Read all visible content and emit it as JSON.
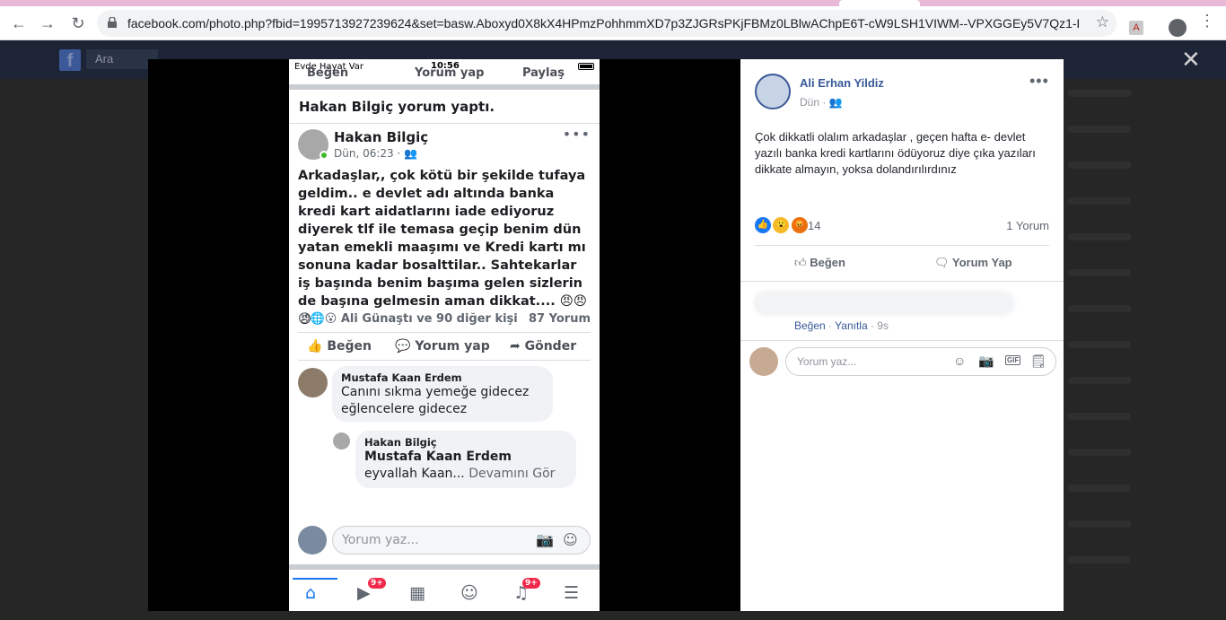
{
  "browser": {
    "url": "facebook.com/photo.php?fbid=1995713927239624&set=basw.Aboxyd0X8kX4HPmzPohhmmXD7p3ZJGRsPKjFBMz0LBlwAChpE6T-cW9LSH1VIWM--VPXGGEy5V7Qz1-Lc6s...",
    "back": "←",
    "forward": "→",
    "reload": "↻",
    "star": "☆",
    "pdf": "A",
    "menu": "⋮"
  },
  "facebook": {
    "logo": "f",
    "search_placeholder": "Ara",
    "close": "✕"
  },
  "phone": {
    "status": {
      "carrier": "Evde Hayat Var",
      "time": "10:56"
    },
    "cut_actions": {
      "like": "Beğen",
      "comment": "Yorum yap",
      "share": "Paylaş"
    },
    "notification": "Hakan Bilgiç yorum yaptı.",
    "post": {
      "author": "Hakan Bilgiç",
      "meta": "Dün, 06:23 · 👥",
      "more": "•••",
      "body": "Arkadaşlar,, çok kötü bir şekilde tufaya geldim.. e devlet adı altında banka kredi kart aidatlarını iade ediyoruz diyerek tlf ile temasa geçip benim dün yatan emekli maaşımı ve Kredi kartı mı sonuna  kadar bosalttilar.. Sahtekarlar iş başında benim başıma gelen sizlerin de başına gelmesin aman dikkat.... 😠😠😠",
      "reactions": "😠🌐😮 Ali Günaştı ve 90 diğer kişi",
      "comments_count": "87 Yorum"
    },
    "actions": {
      "like": "Beğen",
      "comment": "Yorum yap",
      "send": "Gönder"
    },
    "comments": [
      {
        "name": "Mustafa Kaan Erdem",
        "text1": "Canını sıkma yemeğe gidecez",
        "text2": "eğlencelere gidecez"
      },
      {
        "name": "Hakan Bilgiç",
        "text1": "Mustafa Kaan Erdem",
        "text2": "eyvallah Kaan...",
        "more": "Devamını Gör"
      }
    ],
    "composer_placeholder": "Yorum yaz...",
    "tabs": {
      "video_badge": "9+",
      "notif_badge": "9+"
    }
  },
  "panel": {
    "author": "Ali Erhan Yildiz",
    "meta": "Dün · 👥",
    "more": "•••",
    "text": "Çok dikkatli olalım arkadaşlar , geçen hafta e- devlet yazılı banka kredi kartlarını ödüyoruz diye çıka yazıları dikkate almayın, yoksa dolandırılırdınız",
    "reaction_count": "14",
    "comment_count": "1 Yorum",
    "like": "Beğen",
    "comment": "Yorum Yap",
    "comment_meta": {
      "like": "Beğen",
      "reply": "Yanıtla",
      "time": "9s"
    },
    "composer_placeholder": "Yorum yaz..."
  }
}
